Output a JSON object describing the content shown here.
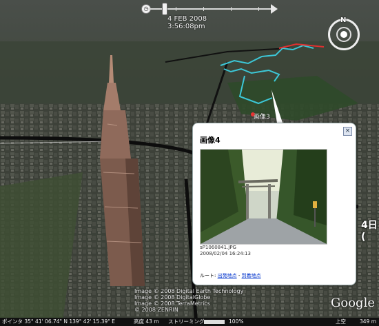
{
  "timeslider": {
    "clock_icon": "clock-icon",
    "date": "4 FEB 2008",
    "time": "3:56:08pm"
  },
  "compass": {
    "north": "N"
  },
  "placemark": {
    "label": "画像3"
  },
  "side_label": "4日(",
  "popup": {
    "title": "画像4",
    "close": "×",
    "filename": "sP1060841.JPG",
    "timestamp": "2008/02/04 16:24:13",
    "route_prefix": "ルート: ",
    "route_from": "出発地点",
    "route_sep": " - ",
    "route_to": "到着地点"
  },
  "attribution": [
    "Image © 2008 Digital Earth Technology",
    "Image © 2008 DigitalGlobe",
    "Image © 2008 TerraMetrics",
    "© 2008 ZENRIN"
  ],
  "logo": "Google",
  "status": {
    "pointer": "ポインタ 35° 41' 06.74\" N  139° 42' 15.39\" E",
    "elevation": "高度   43 m",
    "streaming": "ストリーミング",
    "streaming_pct": "100%",
    "sky_label": "上空",
    "sky": "349 m"
  },
  "colors": {
    "track": "#3cc8d8",
    "accent_red": "#e03030"
  }
}
